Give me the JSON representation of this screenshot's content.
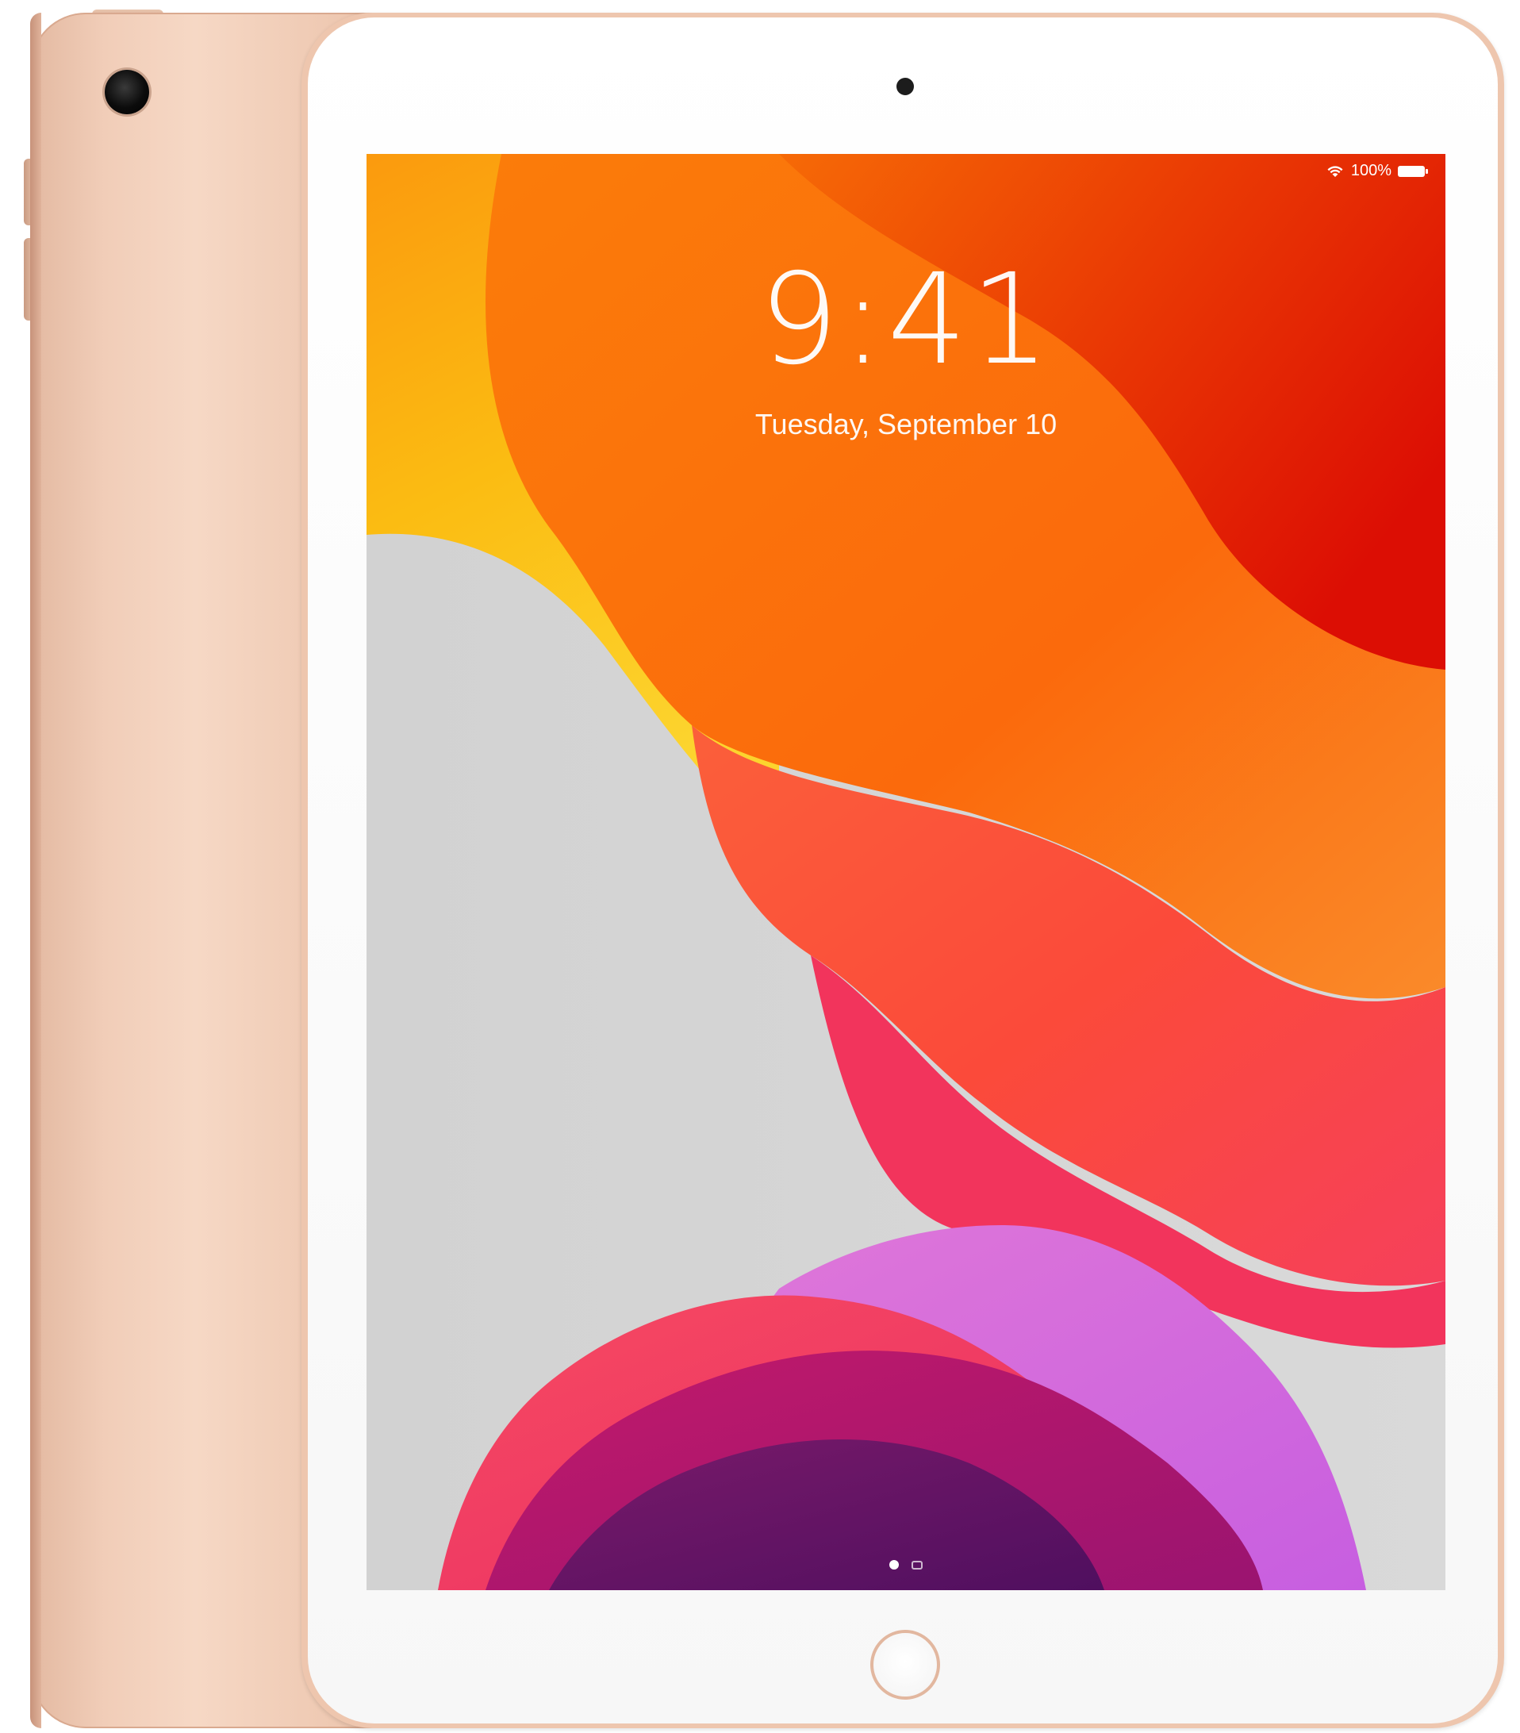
{
  "device": {
    "finish_color": "#f1cdb8",
    "bezel_color": "#ffffff",
    "icons": [
      "rear-camera-icon",
      "front-camera-icon",
      "home-button-icon"
    ]
  },
  "status_bar": {
    "battery_text": "100%",
    "icons": [
      "wifi-icon",
      "battery-icon"
    ]
  },
  "lock_screen": {
    "time": "9:41",
    "date": "Tuesday, September 10",
    "page_indicator": {
      "pages": 2,
      "current": 1,
      "icons": [
        "page-dot",
        "camera-icon"
      ]
    }
  },
  "wallpaper": {
    "colors": {
      "gray": "#d5d5d5",
      "yellow": "#fbbc12",
      "orange": "#fb6c0a",
      "red": "#e11a06",
      "coral": "#fc4f33",
      "pink": "#f6325c",
      "magenta": "#cd2a86",
      "lilac": "#d36be0",
      "purple": "#6b1467"
    }
  }
}
